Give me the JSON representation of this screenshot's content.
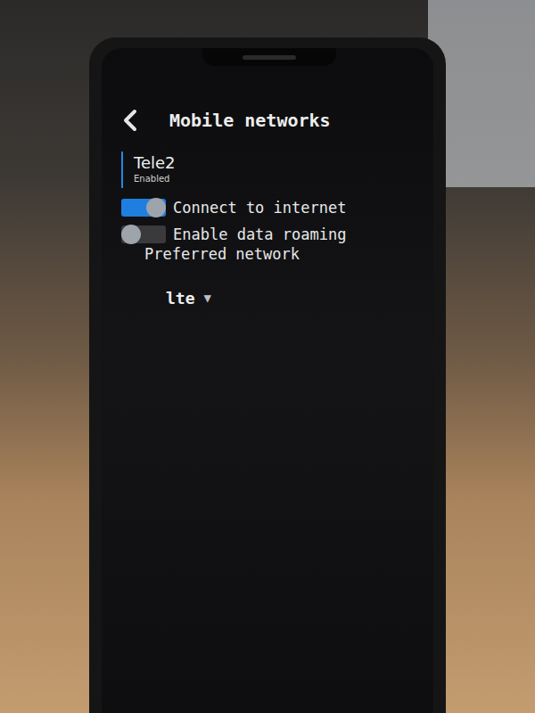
{
  "screen": {
    "title": "Mobile networks"
  },
  "network": {
    "name": "Tele2",
    "status": "Enabled",
    "selected": true
  },
  "toggles": [
    {
      "label": "Connect to internet",
      "on": true
    },
    {
      "label": "Enable data roaming",
      "on": false
    }
  ],
  "preferred_network": {
    "label": "Preferred network",
    "value": "lte",
    "arrow": "▼"
  }
}
